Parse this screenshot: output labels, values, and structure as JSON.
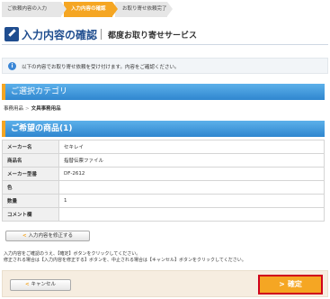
{
  "steps": [
    {
      "label": "ご依頼内容の入力"
    },
    {
      "label": "入力内容の確認"
    },
    {
      "label": "お取り寄せ依頼完了"
    }
  ],
  "title": {
    "main": "入力内容の確認",
    "sub": "都度お取り寄せサービス"
  },
  "notice": {
    "text": "以下の内容でお取り寄せ依頼を受け付けます。内容をご確認ください。"
  },
  "category_section": {
    "title": "ご選択カテゴリ",
    "breadcrumb": [
      "事務用品",
      "文具事務用品"
    ]
  },
  "product_section": {
    "title": "ご希望の商品(1)",
    "rows": [
      {
        "label": "メーカー名",
        "value": "セキレイ"
      },
      {
        "label": "商品名",
        "value": "指替伝票ファイル"
      },
      {
        "label": "メーカー型番",
        "value": "DF-2612"
      },
      {
        "label": "色",
        "value": ""
      },
      {
        "label": "数量",
        "value": "1"
      },
      {
        "label": "コメント欄",
        "value": ""
      }
    ]
  },
  "edit_button": {
    "label": "入力内容を修正する"
  },
  "help": {
    "line1": "入力内容をご確認のうえ、【確定】ボタンをクリックしてください。",
    "line2": "修正される場合は【入力内容を修正する】ボタンを、中止される場合は【キャンセル】ボタンをクリックしてください。"
  },
  "footer": {
    "cancel_label": "キャンセル",
    "confirm_label": "確定"
  },
  "colors": {
    "accent_orange": "#f5a623",
    "section_blue": "#2f86cf",
    "title_blue": "#1f4d8f",
    "confirm_border_red": "#d0021b"
  }
}
